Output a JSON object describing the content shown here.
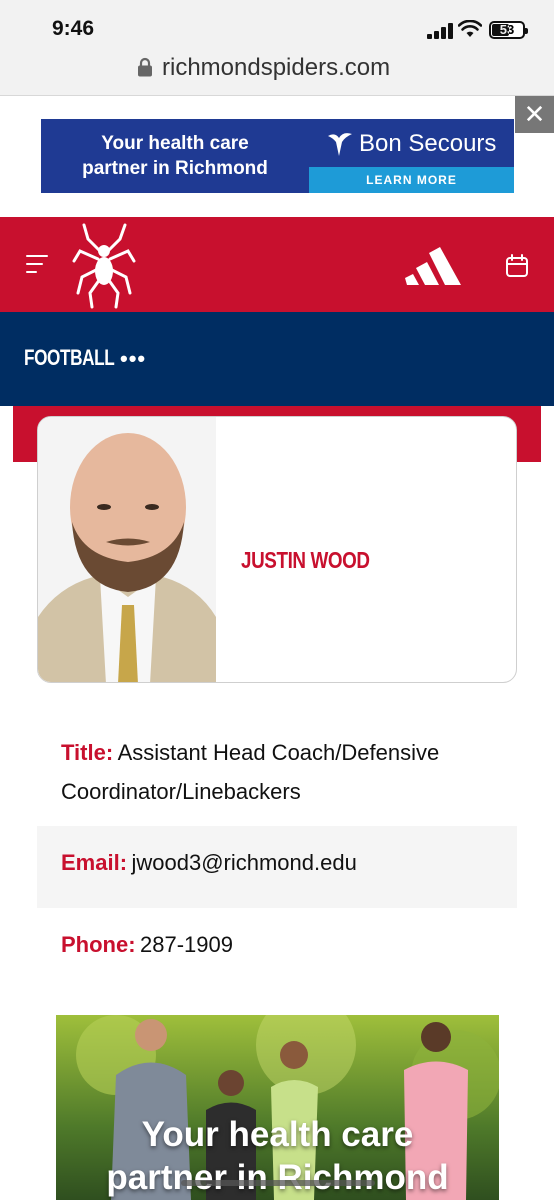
{
  "status_bar": {
    "time": "9:46",
    "battery": "53"
  },
  "browser": {
    "url": "richmondspiders.com"
  },
  "top_ad": {
    "text_line1": "Your health care",
    "text_line2": "partner in Richmond",
    "brand": "Bon Secours",
    "cta": "LEARN MORE",
    "close_symbol": "✕"
  },
  "header": {
    "menu_icon": "hamburger-menu",
    "logo": "spider-logo",
    "sponsor": "adidas-logo",
    "calendar_icon": "calendar"
  },
  "sport_nav": {
    "label": "FOOTBALL",
    "more": "•••"
  },
  "profile": {
    "name": "JUSTIN WOOD"
  },
  "details": {
    "title_label": "Title:",
    "title_value": "Assistant Head Coach/Defensive Coordinator/Linebackers",
    "email_label": "Email:",
    "email_value": "jwood3@richmond.edu",
    "phone_label": "Phone:",
    "phone_value": "287-1909"
  },
  "bottom_ad": {
    "line1": "Your health care",
    "line2": "partner in Richmond"
  },
  "colors": {
    "red": "#c8102e",
    "navy": "#002d62",
    "ad_blue": "#1f3a93",
    "ad_cyan": "#1e9bd7"
  }
}
